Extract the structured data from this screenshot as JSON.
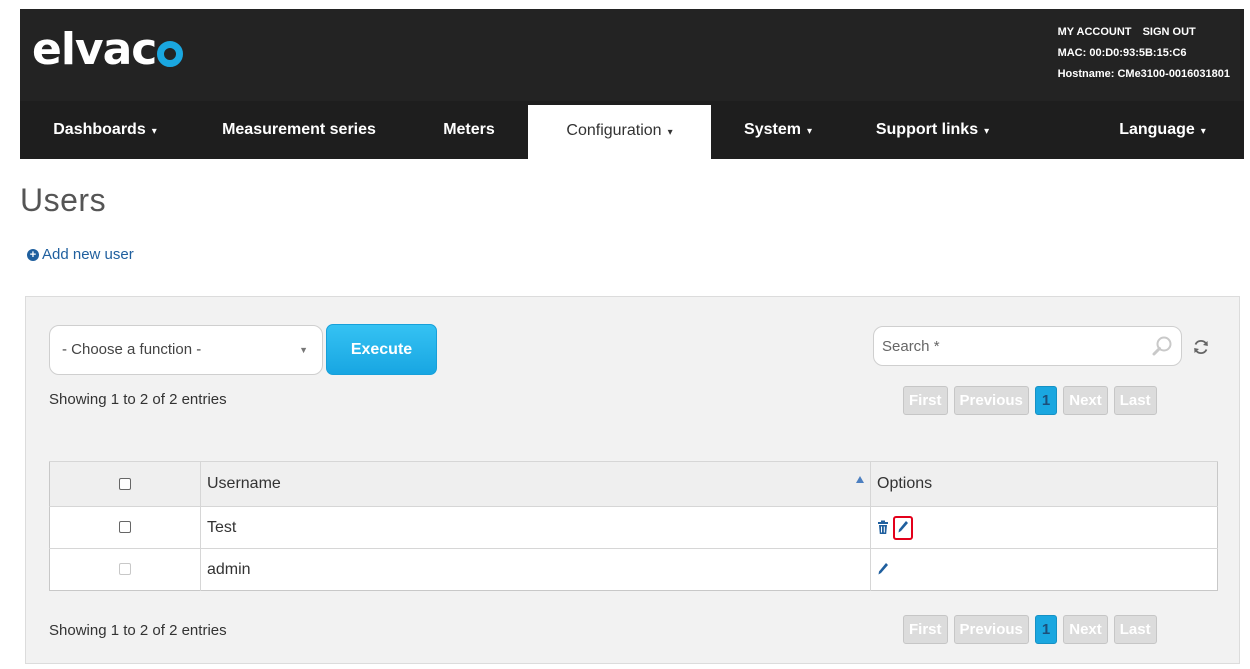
{
  "header": {
    "logo_text": "elvac",
    "account": {
      "my_account": "MY ACCOUNT",
      "sign_out": "SIGN OUT",
      "mac": "MAC: 00:D0:93:5B:15:C6",
      "hostname": "Hostname: CMe3100-0016031801"
    }
  },
  "nav": {
    "items": [
      {
        "label": "Dashboards",
        "caret": "▾"
      },
      {
        "label": "Measurement series"
      },
      {
        "label": "Meters"
      },
      {
        "label": "Configuration",
        "caret": "▾",
        "active": true
      },
      {
        "label": "System",
        "caret": "▾"
      },
      {
        "label": "Support links",
        "caret": "▾"
      },
      {
        "label": "Language",
        "caret": "▾"
      }
    ]
  },
  "page": {
    "title": "Users",
    "add_user": "Add new user"
  },
  "toolbar": {
    "function_select": "- Choose a function -",
    "execute_label": "Execute",
    "search_placeholder": "Search *"
  },
  "info": {
    "showing_top": "Showing 1 to 2 of 2 entries",
    "showing_bottom": "Showing 1 to 2 of 2 entries"
  },
  "pagination": {
    "first": "First",
    "previous": "Previous",
    "current": "1",
    "next": "Next",
    "last": "Last"
  },
  "table": {
    "columns": [
      "Username",
      "Options"
    ],
    "rows": [
      {
        "username": "Test",
        "options": [
          "delete",
          "edit"
        ]
      },
      {
        "username": "admin",
        "options": [
          "edit"
        ]
      }
    ]
  },
  "colors": {
    "accent": "#1aa7e0",
    "header_bg": "#232323",
    "highlight": "#e3001b",
    "link": "#1f5f9e"
  }
}
